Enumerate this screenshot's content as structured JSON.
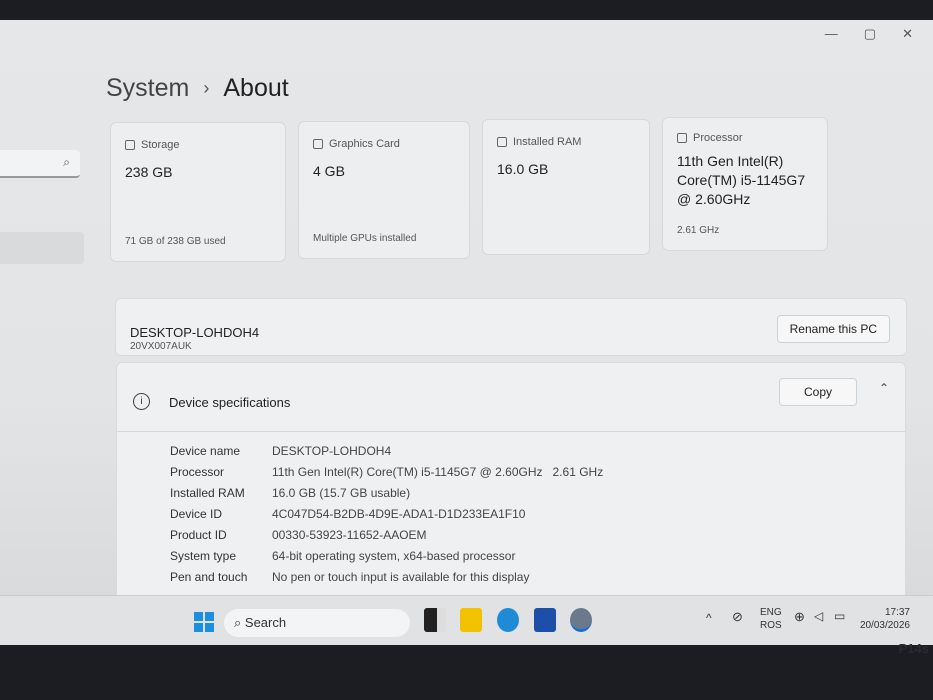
{
  "window": {
    "minimize": "—",
    "maximize": "▢",
    "close": "✕"
  },
  "header": {
    "crumb": "System",
    "title": "About"
  },
  "sidebar": {
    "search_icon": "search-icon"
  },
  "cards": [
    {
      "label": "Storage",
      "value": "238 GB",
      "sub": "71 GB of 238 GB used"
    },
    {
      "label": "Graphics Card",
      "value": "4 GB",
      "sub": "Multiple GPUs installed"
    },
    {
      "label": "Installed RAM",
      "value": "16.0 GB",
      "sub": ""
    },
    {
      "label": "Processor",
      "value": "11th Gen Intel(R) Core(TM) i5-1145G7 @ 2.60GHz",
      "sub": "2.61 GHz"
    }
  ],
  "pc": {
    "name": "DESKTOP-LOHDOH4",
    "model": "20VX007AUK",
    "rename": "Rename this PC"
  },
  "device_specs": {
    "title": "Device specifications",
    "copy": "Copy",
    "rows": [
      {
        "k": "Device name",
        "v": "DESKTOP-LOHDOH4"
      },
      {
        "k": "Processor",
        "v": "11th Gen Intel(R) Core(TM) i5-1145G7 @ 2.60GHz   2.61 GHz"
      },
      {
        "k": "Installed RAM",
        "v": "16.0 GB (15.7 GB usable)"
      },
      {
        "k": "Device ID",
        "v": "4C047D54-B2DB-4D9E-ADA1-D1D233EA1F10"
      },
      {
        "k": "Product ID",
        "v": "00330-53923-11652-AAOEM"
      },
      {
        "k": "System type",
        "v": "64-bit operating system, x64-based processor"
      },
      {
        "k": "Pen and touch",
        "v": "No pen or touch input is available for this display"
      }
    ]
  },
  "taskbar": {
    "search": "Search",
    "lang1": "ENG",
    "lang2": "ROS",
    "time": "17:37",
    "date": "20/03/2026"
  },
  "bezel": {
    "model": "P14s"
  }
}
